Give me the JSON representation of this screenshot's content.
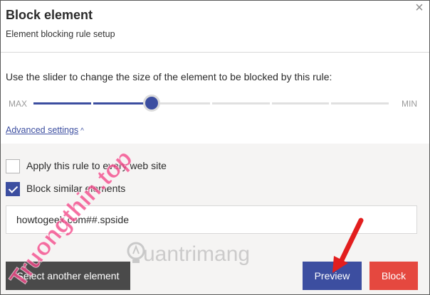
{
  "dialog": {
    "title": "Block element",
    "subtitle": "Element blocking rule setup",
    "close_icon": "×"
  },
  "slider": {
    "description": "Use the slider to change the size of the element to be blocked by this rule:",
    "max_label": "MAX",
    "min_label": "MIN",
    "segments": 6,
    "selected_index": 2
  },
  "advanced": {
    "label": "Advanced settings",
    "chevron": "^"
  },
  "options": [
    {
      "label": "Apply this rule to every web site",
      "checked": false
    },
    {
      "label": "Block similar elements",
      "checked": true
    }
  ],
  "rule_input": {
    "value": "howtogeek.com##.spside"
  },
  "buttons": {
    "select_another": "Select another element",
    "preview": "Preview",
    "block": "Block"
  },
  "watermark": {
    "arc_text": "Truongthin.top",
    "brand_text": "uantrimang"
  },
  "colors": {
    "accent": "#3c4ea0",
    "danger": "#e5483f",
    "dark_button": "#4a4a4a",
    "arrow": "#e21e1e",
    "watermark_pink": "#f24a8a"
  }
}
